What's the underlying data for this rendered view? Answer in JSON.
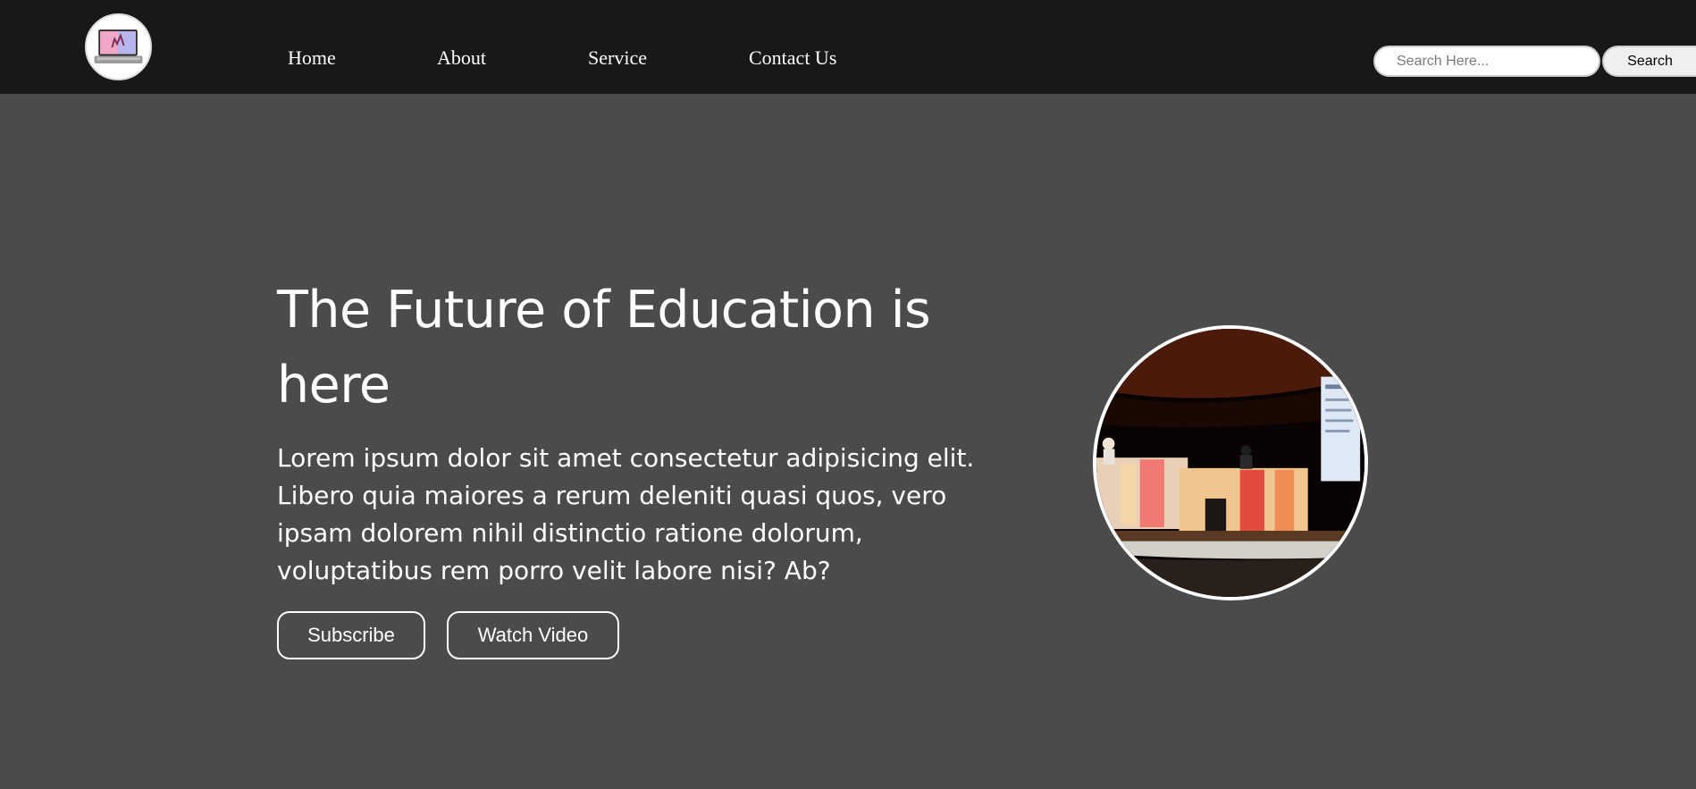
{
  "nav": {
    "logo_icon": "laptop-logo-icon",
    "links": [
      {
        "label": "Home"
      },
      {
        "label": "About"
      },
      {
        "label": "Service"
      },
      {
        "label": "Contact Us"
      }
    ]
  },
  "search": {
    "placeholder": "Search Here...",
    "value": "",
    "button_label": "Search"
  },
  "hero": {
    "title": "The Future of Education is here",
    "text": "Lorem ipsum dolor sit amet consectetur adipisicing elit. Libero quia maiores a rerum deleniti quasi quos, vero ipsam dolorem nihil distinctio ratione dolorum, voluptatibus rem porro velit labore nisi? Ab?",
    "subscribe_label": "Subscribe",
    "watch_label": "Watch Video",
    "image": "conference-stage-photo"
  },
  "colors": {
    "navbar_bg": "#181818",
    "page_bg": "#4b4b4b",
    "text": "#ffffff"
  }
}
